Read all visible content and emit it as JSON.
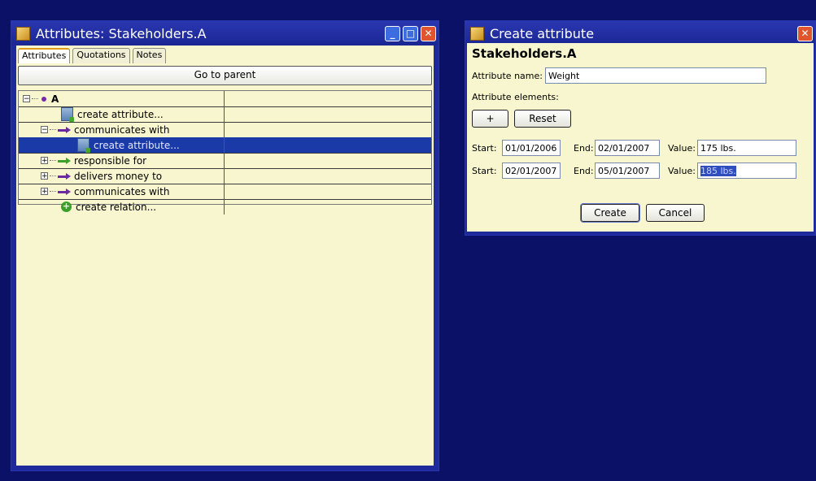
{
  "attributes_window": {
    "title": "Attributes: Stakeholders.A",
    "tabs": [
      "Attributes",
      "Quotations",
      "Notes"
    ],
    "go_to_parent": "Go to parent",
    "tree": [
      {
        "label": "A"
      },
      {
        "label": "create attribute..."
      },
      {
        "label": "communicates with"
      },
      {
        "label": "create attribute..."
      },
      {
        "label": "responsible for"
      },
      {
        "label": "delivers money to"
      },
      {
        "label": "communicates with"
      },
      {
        "label": "create relation..."
      }
    ],
    "expander_minus": "−",
    "expander_plus": "+"
  },
  "create_window": {
    "title": "Create attribute",
    "heading": "Stakeholders.A",
    "attribute_name_label": "Attribute name:",
    "attribute_name_value": "Weight",
    "attribute_elements_label": "Attribute elements:",
    "add_label": "+",
    "reset_label": "Reset",
    "rows": [
      {
        "start_label": "Start:",
        "start": "01/01/2006",
        "end_label": "End:",
        "end": "02/01/2007",
        "value_label": "Value:",
        "value": "175 lbs."
      },
      {
        "start_label": "Start:",
        "start": "02/01/2007",
        "end_label": "End:",
        "end": "05/01/2007",
        "value_label": "Value:",
        "value": "185 lbs."
      }
    ],
    "create_label": "Create",
    "cancel_label": "Cancel",
    "close_glyph": "✕"
  },
  "colors": {
    "desktop": "#0b1166",
    "titlebar": "#1e2a9c",
    "panel": "#f8f6cf",
    "selection": "#1a3aa8"
  }
}
